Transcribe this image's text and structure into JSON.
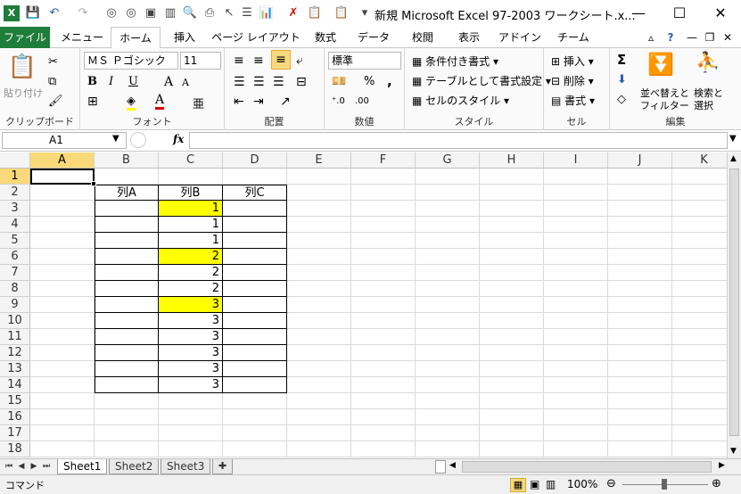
{
  "window": {
    "title": "新規 Microsoft Excel 97-2003 ワークシート.x...",
    "minimize": "—",
    "maximize": "☐",
    "close": "✕"
  },
  "ribbon": {
    "tabs": [
      "ファイル",
      "メニュー",
      "ホーム",
      "挿入",
      "ページ レイアウト",
      "数式",
      "データ",
      "校閲",
      "表示",
      "アドイン",
      "チーム"
    ],
    "active_tab": "ホーム",
    "clipboard": {
      "paste": "貼り付け",
      "label": "クリップボード"
    },
    "font": {
      "name": "ＭＳ Ｐゴシック",
      "size": "11",
      "bold": "B",
      "italic": "I",
      "underline": "U",
      "grow": "A",
      "shrink": "A",
      "label": "フォント"
    },
    "alignment": {
      "label": "配置"
    },
    "number": {
      "format": "標準",
      "percent": "%",
      "comma": ",",
      "label": "数値"
    },
    "styles": {
      "conditional": "条件付き書式",
      "table": "テーブルとして書式設定",
      "cell": "セルのスタイル",
      "label": "スタイル"
    },
    "cells": {
      "insert": "挿入",
      "delete": "削除",
      "format": "書式",
      "label": "セル"
    },
    "editing": {
      "sum": "Σ",
      "sort": "並べ替えと",
      "sort2": "フィルター",
      "find": "検索と",
      "find2": "選択",
      "label": "編集"
    }
  },
  "formula_bar": {
    "name_box": "A1",
    "fx": "fx",
    "value": ""
  },
  "grid": {
    "columns": [
      "A",
      "B",
      "C",
      "D",
      "E",
      "F",
      "G",
      "H",
      "I",
      "J",
      "K"
    ],
    "rows": [
      "1",
      "2",
      "3",
      "4",
      "5",
      "6",
      "7",
      "8",
      "9",
      "10",
      "11",
      "12",
      "13",
      "14",
      "15",
      "16",
      "17",
      "18"
    ],
    "selected_cell": "A1",
    "headers": {
      "B2": "列A",
      "C2": "列B",
      "D2": "列C"
    },
    "column_b_values": [
      "1",
      "1",
      "1",
      "2",
      "2",
      "2",
      "3",
      "3",
      "3",
      "3",
      "3",
      "3"
    ],
    "highlight_color": "#ffff00",
    "highlighted_rows": [
      3,
      6,
      9
    ]
  },
  "sheets": {
    "tabs": [
      "Sheet1",
      "Sheet2",
      "Sheet3"
    ],
    "active": "Sheet1"
  },
  "status": {
    "mode": "コマンド",
    "zoom": "100%"
  },
  "colors": {
    "file_tab": "#1e7d3a",
    "selection_header": "#f9d97a",
    "cell_border": "#000000"
  }
}
